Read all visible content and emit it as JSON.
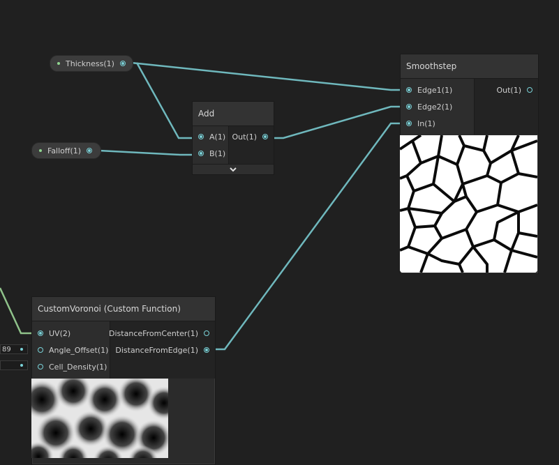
{
  "nodes": {
    "thickness": {
      "label": "Thickness(1)"
    },
    "falloff": {
      "label": "Falloff(1)"
    },
    "add": {
      "title": "Add",
      "inputs": [
        "A(1)",
        "B(1)"
      ],
      "output": "Out(1)"
    },
    "smoothstep": {
      "title": "Smoothstep",
      "inputs": [
        "Edge1(1)",
        "Edge2(1)",
        "In(1)"
      ],
      "output": "Out(1)"
    },
    "voronoi": {
      "title": "CustomVoronoi (Custom Function)",
      "inputs": [
        "UV(2)",
        "Angle_Offset(1)",
        "Cell_Density(1)"
      ],
      "outputs": [
        "DistanceFromCenter(1)",
        "DistanceFromEdge(1)"
      ],
      "angle_offset_value": "89",
      "cell_density_value": ""
    }
  },
  "colors": {
    "wire": "#6fb8bd",
    "uv_wire": "#8fc28a",
    "port": "#7ad2d8",
    "background": "#202020"
  },
  "icons": {
    "add_expand": "chevron-down-icon"
  }
}
